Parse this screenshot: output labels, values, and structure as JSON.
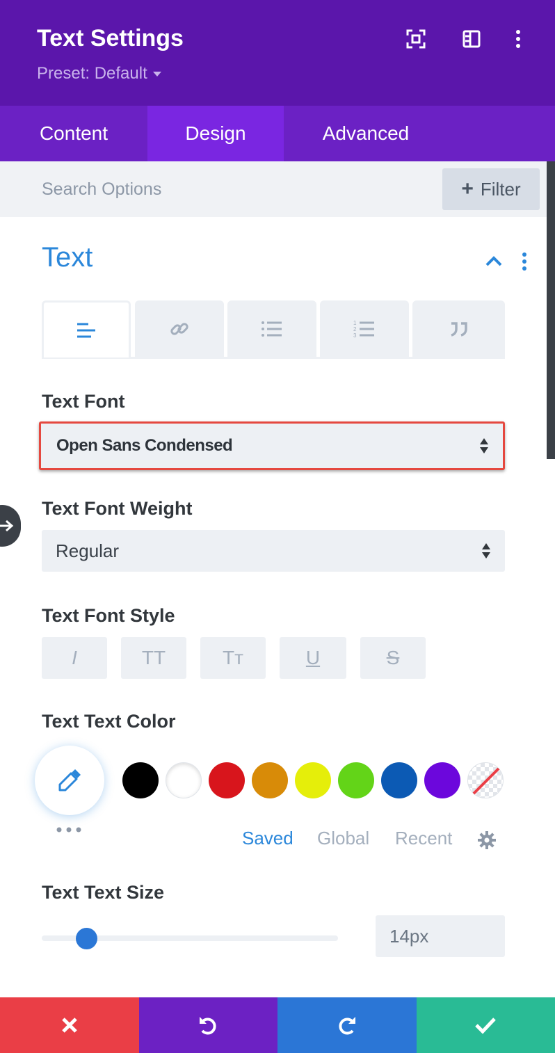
{
  "header": {
    "title": "Text Settings",
    "preset": "Preset: Default",
    "color": "#5b16ab"
  },
  "tabs": [
    {
      "label": "Content",
      "active": false
    },
    {
      "label": "Design",
      "active": true
    },
    {
      "label": "Advanced",
      "active": false
    }
  ],
  "search": {
    "placeholder": "Search Options",
    "filter_label": "Filter"
  },
  "section": {
    "title": "Text"
  },
  "subtabs": [
    {
      "icon": "align-left-icon",
      "active": true
    },
    {
      "icon": "link-icon",
      "active": false
    },
    {
      "icon": "bulleted-list-icon",
      "active": false
    },
    {
      "icon": "numbered-list-icon",
      "active": false
    },
    {
      "icon": "quote-icon",
      "active": false
    }
  ],
  "fields": {
    "font_label": "Text Font",
    "font_value": "Open Sans Condensed",
    "weight_label": "Text Font Weight",
    "weight_value": "Regular",
    "style_label": "Text Font Style",
    "style_buttons": [
      "I",
      "TT",
      "Tт",
      "U",
      "S"
    ],
    "color_label": "Text Text Color",
    "size_label": "Text Text Size",
    "size_value": "14px",
    "size_slider_fraction": 0.15
  },
  "swatches": [
    "#000000",
    "#ffffff",
    "#d8151c",
    "#d88b08",
    "#e5ee0a",
    "#63d418",
    "#0c5ab4",
    "#6c07dc"
  ],
  "palette_tabs": [
    "Saved",
    "Global",
    "Recent"
  ],
  "footer": {
    "colors": [
      "#ea3e46",
      "#6c21c3",
      "#2b76d6",
      "#29bb95"
    ]
  },
  "accent": "#2b87da"
}
